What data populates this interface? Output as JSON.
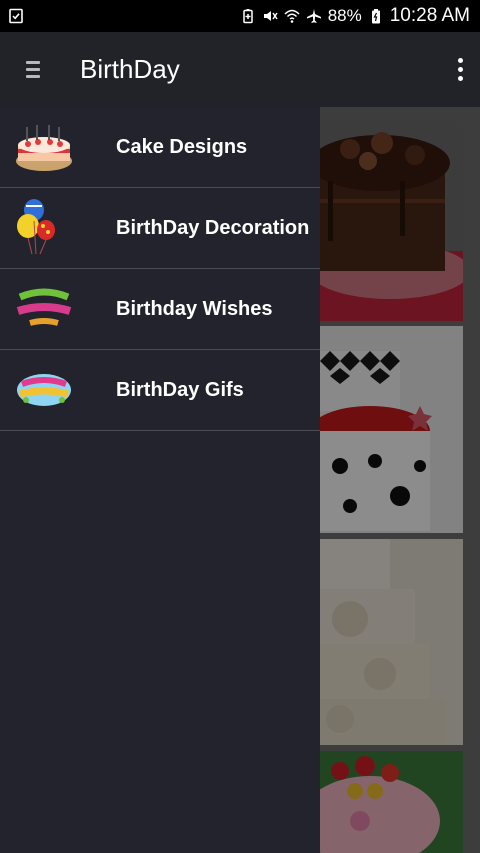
{
  "status_bar": {
    "battery": "88%",
    "time": "10:28 AM",
    "icons": [
      "task-check-icon",
      "battery-saver-icon",
      "mute-icon",
      "wifi-icon",
      "airplane-icon",
      "battery-icon"
    ]
  },
  "app_bar": {
    "title": "BirthDay",
    "menu_icon": "hamburger-menu-icon",
    "overflow_icon": "more-vert-icon"
  },
  "drawer": {
    "items": [
      {
        "label": "Cake Designs",
        "icon": "cake-icon"
      },
      {
        "label": "BirthDay Decoration",
        "icon": "balloons-icon"
      },
      {
        "label": "Birthday Wishes",
        "icon": "happy-birthday-text-icon"
      },
      {
        "label": "BirthDay Gifs",
        "icon": "happy-birthday-badge-icon"
      }
    ]
  },
  "colors": {
    "app_bar": "#222329",
    "drawer": "#22232d",
    "divider": "#4a4b55",
    "text": "#ffffff"
  }
}
